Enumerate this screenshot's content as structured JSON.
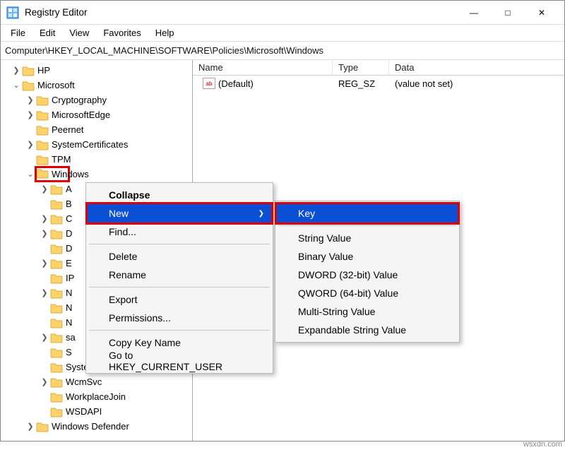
{
  "window": {
    "title": "Registry Editor"
  },
  "menus": {
    "file": "File",
    "edit": "Edit",
    "view": "View",
    "favorites": "Favorites",
    "help": "Help"
  },
  "address": "Computer\\HKEY_LOCAL_MACHINE\\SOFTWARE\\Policies\\Microsoft\\Windows",
  "tree": {
    "hp": "HP",
    "microsoft": "Microsoft",
    "children": {
      "cryptography": "Cryptography",
      "microsoftedge": "MicrosoftEdge",
      "peernet": "Peernet",
      "systemcertificates": "SystemCertificates",
      "tpm": "TPM",
      "windows": "Windows",
      "win_children": {
        "a": "A",
        "b": "B",
        "c": "C",
        "d1": "D",
        "d2": "D",
        "e": "E",
        "ip": "IP",
        "n1": "N",
        "n2": "N",
        "n3": "N",
        "sa": "sa",
        "se": "S",
        "system": "System",
        "wcmsvc": "WcmSvc",
        "workplacejoin": "WorkplaceJoin",
        "wsdapi": "WSDAPI"
      },
      "windowsdefender": "Windows Defender"
    }
  },
  "list": {
    "headers": {
      "name": "Name",
      "type": "Type",
      "data": "Data"
    },
    "row": {
      "name": "(Default)",
      "type": "REG_SZ",
      "data": "(value not set)"
    }
  },
  "ctx1": {
    "collapse": "Collapse",
    "new": "New",
    "find": "Find...",
    "delete": "Delete",
    "rename": "Rename",
    "export": "Export",
    "permissions": "Permissions...",
    "copykey": "Copy Key Name",
    "goto": "Go to HKEY_CURRENT_USER"
  },
  "ctx2": {
    "key": "Key",
    "string": "String Value",
    "binary": "Binary Value",
    "dword": "DWORD (32-bit) Value",
    "qword": "QWORD (64-bit) Value",
    "multi": "Multi-String Value",
    "expand": "Expandable String Value"
  },
  "watermark": "wsxdn.com"
}
